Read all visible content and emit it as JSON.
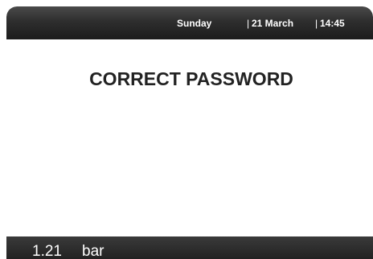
{
  "header": {
    "day": "Sunday",
    "separator": "|",
    "date": "21 March",
    "time": "14:45"
  },
  "main": {
    "message": "CORRECT PASSWORD"
  },
  "footer": {
    "pressure_value": "1.21",
    "pressure_unit": "bar"
  },
  "colors": {
    "header_background": "#1c1c1c",
    "footer_background": "#222222",
    "message_text": "#222222",
    "screen_background": "#ffffff"
  }
}
